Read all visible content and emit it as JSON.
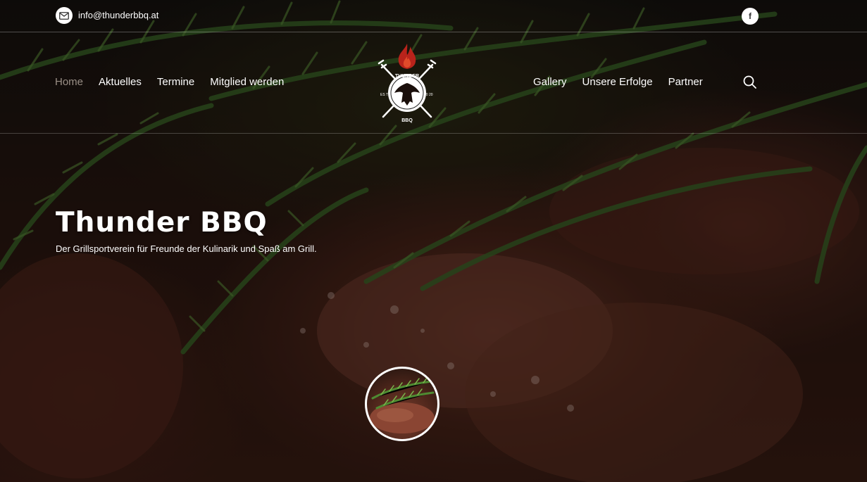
{
  "topbar": {
    "email": "info@thunderbbq.at",
    "email_icon": "envelope-icon",
    "social_icon": "facebook-icon",
    "social_label": "f"
  },
  "nav": {
    "left": [
      "Home",
      "Aktuelles",
      "Termine",
      "Mitglied werden"
    ],
    "right": [
      "Gallery",
      "Unsere Erfolge",
      "Partner"
    ],
    "active": "Home",
    "search_icon": "search-icon"
  },
  "logo": {
    "top_text": "THUNDER",
    "bottom_text": "BBQ",
    "left_text": "ES TD",
    "right_text": "20 20"
  },
  "hero": {
    "title": "Thunder BBQ",
    "subtitle": "Der Grillsportverein für Freunde der Kulinarik und Spaß am Grill."
  },
  "colors": {
    "active_nav": "#9a8f86",
    "flame": "#b8231b",
    "text": "#ffffff"
  }
}
